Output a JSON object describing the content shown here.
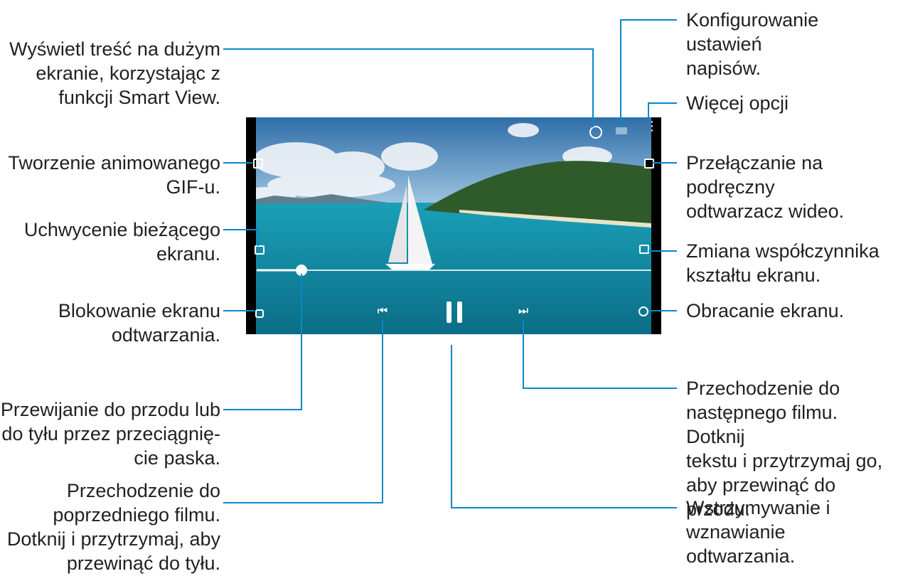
{
  "callouts": {
    "smart_view": "Wyświetl treść na dużym\nekranie, korzystając z\nfunkcji Smart View.",
    "gif": "Tworzenie animowanego\nGIF-u.",
    "capture": "Uchwycenie bieżącego\nekranu.",
    "lock": "Blokowanie ekranu\nodtwarzania.",
    "seek": "Przewijanie do przodu lub\ndo tyłu przez przeciągnię-\ncie paska.",
    "previous": "Przechodzenie do\npoprzedniego filmu.\nDotknij i przytrzymaj, aby\nprzewinąć do tyłu.",
    "subtitles": "Konfigurowanie ustawień\nnapisów.",
    "more": "Więcej opcji",
    "popup": "Przełączanie na podręczny\nodtwarzacz wideo.",
    "ratio": "Zmiana współczynnika\nkształtu ekranu.",
    "rotate": "Obracanie ekranu.",
    "next": "Przechodzenie do\nnastępnego filmu. Dotknij\ntekstu i przytrzymaj go,\naby przewinąć do przodu.",
    "pause": "Wstrzymywanie i\nwznawianie odtwarzania."
  },
  "player": {
    "progress_fraction": 0.12,
    "icons": {
      "smart_view": "smart-view-icon",
      "subtitles": "subtitles-icon",
      "more": "more-options-icon",
      "gif": "gif-icon",
      "popup": "popup-player-icon",
      "capture": "capture-icon",
      "ratio": "aspect-ratio-icon",
      "lock": "lock-icon",
      "rotate": "rotate-icon",
      "previous": "previous-icon",
      "pause": "pause-icon",
      "next": "next-icon"
    }
  },
  "colors": {
    "leader": "#0a87c9",
    "text": "#231f20"
  }
}
